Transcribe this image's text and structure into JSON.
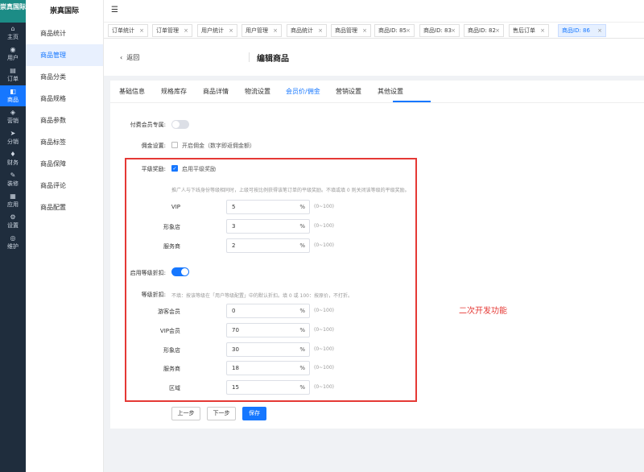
{
  "app": {
    "logo": "崇真国际",
    "menu_title": "崇真国际"
  },
  "rail": [
    {
      "icon": "home-icon",
      "glyph": "⌂",
      "label": "主页"
    },
    {
      "icon": "user-icon",
      "glyph": "◉",
      "label": "用户"
    },
    {
      "icon": "order-icon",
      "glyph": "▤",
      "label": "订单"
    },
    {
      "icon": "product-icon",
      "glyph": "◧",
      "label": "商品"
    },
    {
      "icon": "marketing-icon",
      "glyph": "◈",
      "label": "营销"
    },
    {
      "icon": "distribution-icon",
      "glyph": "➤",
      "label": "分销"
    },
    {
      "icon": "finance-icon",
      "glyph": "♦",
      "label": "财务"
    },
    {
      "icon": "decor-icon",
      "glyph": "✎",
      "label": "装修"
    },
    {
      "icon": "apps-icon",
      "glyph": "▦",
      "label": "应用"
    },
    {
      "icon": "settings-icon",
      "glyph": "⚙",
      "label": "设置"
    },
    {
      "icon": "maintain-icon",
      "glyph": "◎",
      "label": "维护"
    }
  ],
  "menu": [
    "商品统计",
    "商品管理",
    "商品分类",
    "商品规格",
    "商品参数",
    "商品标签",
    "商品保障",
    "商品评论",
    "商品配置"
  ],
  "tabs": [
    "订单统计",
    "订单管理",
    "用户统计",
    "用户管理",
    "商品统计",
    "商品管理",
    "商品ID: 85",
    "商品ID: 83",
    "商品ID: 82",
    "售后订单",
    "商品ID: 86"
  ],
  "header": {
    "back": "返回",
    "title": "编辑商品"
  },
  "subtabs": [
    "基础信息",
    "规格库存",
    "商品详情",
    "物流设置",
    "会员价/佣金",
    "营销设置",
    "其他设置"
  ],
  "form": {
    "paid_member_label": "付费会员专属:",
    "commission_label": "佣金设置:",
    "commission_text": "开启佣金（数字即返佣金额）",
    "peer_label": "平级奖励:",
    "peer_text": "启用平级奖励",
    "peer_desc": "推广人与下线身份等级相同时，上级可按比例获得该笔订单的平级奖励。不填或填 0 则关闭该等级的平级奖励。",
    "peer_rows": [
      {
        "label": "VIP",
        "value": "5"
      },
      {
        "label": "形象店",
        "value": "3"
      },
      {
        "label": "服务商",
        "value": "2"
      }
    ],
    "level_discount_label": "启用等级折扣:",
    "level_label": "等级折扣:",
    "level_desc": "不填：按该等级在「用户等级配置」中的默认折扣。填 0 或 100：按原价，不打折。",
    "level_rows": [
      {
        "label": "游客会员",
        "value": "0"
      },
      {
        "label": "VIP会员",
        "value": "70"
      },
      {
        "label": "形象店",
        "value": "30"
      },
      {
        "label": "服务商",
        "value": "18"
      },
      {
        "label": "区域",
        "value": "15"
      }
    ],
    "unit": "%",
    "range": "(0~100)"
  },
  "buttons": {
    "prev": "上一步",
    "next": "下一步",
    "save": "保存"
  },
  "annotation": "二次开发功能",
  "colors": {
    "primary": "#1677ff",
    "annotation": "#e53935",
    "rail": "#1f2d3d",
    "logo": "#1c8c86"
  }
}
